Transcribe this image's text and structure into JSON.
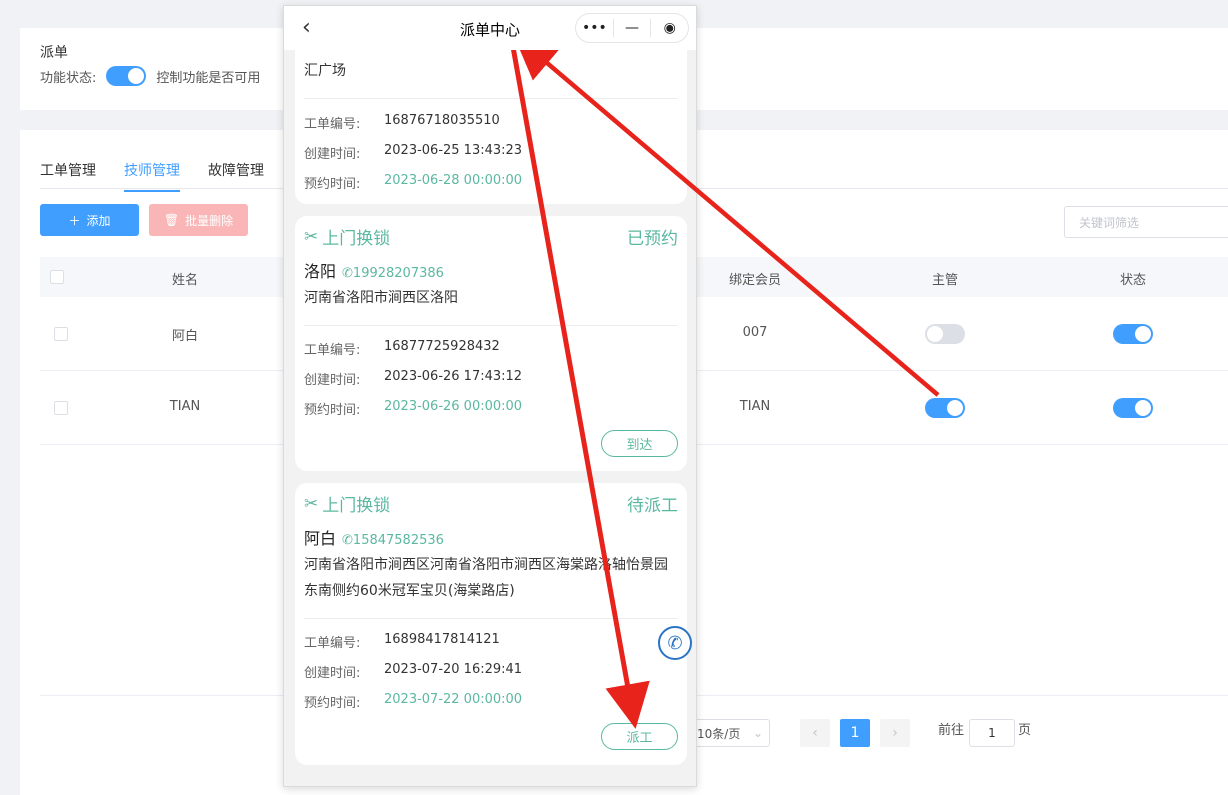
{
  "admin": {
    "title": "派单",
    "function_status_label": "功能状态:",
    "function_status_desc": "控制功能是否可用",
    "tabs": [
      {
        "label": "工单管理"
      },
      {
        "label": "技师管理"
      },
      {
        "label": "故障管理"
      }
    ],
    "add_label": "添加",
    "batch_delete_label": "批量删除",
    "search_placeholder": "关键词筛选",
    "columns": {
      "name": "姓名",
      "member": "绑定会员",
      "manager": "主管",
      "status": "状态"
    },
    "rows": [
      {
        "name": "阿白",
        "member": "007",
        "manager": false,
        "status": true
      },
      {
        "name": "TIAN",
        "member": "TIAN",
        "manager": true,
        "status": true
      }
    ],
    "pagination": {
      "page_size": "10条/页",
      "current_page": "1",
      "goto_label": "前往",
      "goto_value": "1",
      "page_unit": "页"
    }
  },
  "phone": {
    "nav_title": "派单中心",
    "orders": [
      {
        "address_tail": "汇广场",
        "order_no_label": "工单编号:",
        "order_no": "16876718035510",
        "created_label": "创建时间:",
        "created": "2023-06-25 13:43:23",
        "booking_label": "预约时间:",
        "booking": "2023-06-28 00:00:00"
      },
      {
        "service": "上门换锁",
        "status": "已预约",
        "name": "洛阳",
        "phone": "19928207386",
        "address": "河南省洛阳市涧西区洛阳",
        "order_no_label": "工单编号:",
        "order_no": "16877725928432",
        "created_label": "创建时间:",
        "created": "2023-06-26 17:43:12",
        "booking_label": "预约时间:",
        "booking": "2023-06-26 00:00:00",
        "action": "到达"
      },
      {
        "service": "上门换锁",
        "status": "待派工",
        "name": "阿白",
        "phone": "15847582536",
        "address": "河南省洛阳市涧西区河南省洛阳市涧西区海棠路洛轴怡景园东南侧约60米冠军宝贝(海棠路店)",
        "order_no_label": "工单编号:",
        "order_no": "16898417814121",
        "created_label": "创建时间:",
        "created": "2023-07-20 16:29:41",
        "booking_label": "预约时间:",
        "booking": "2023-07-22 00:00:00",
        "action": "派工"
      }
    ]
  },
  "colors": {
    "primary": "#409eff",
    "teal": "#5bb8a0",
    "danger_light": "#fab6b6",
    "annotation": "#e8231b"
  }
}
